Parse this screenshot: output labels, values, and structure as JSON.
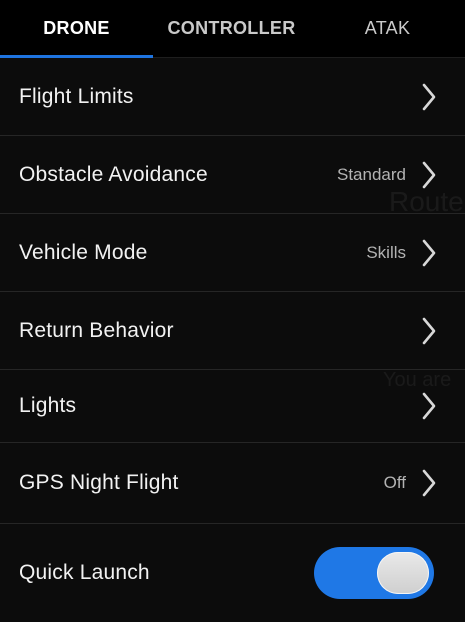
{
  "tabs": [
    {
      "label": "DRONE",
      "active": true
    },
    {
      "label": "CONTROLLER",
      "active": false
    },
    {
      "label": "ATAK",
      "active": false
    }
  ],
  "settings": [
    {
      "label": "Flight Limits",
      "value": ""
    },
    {
      "label": "Obstacle Avoidance",
      "value": "Standard"
    },
    {
      "label": "Vehicle Mode",
      "value": "Skills"
    },
    {
      "label": "Return Behavior",
      "value": ""
    },
    {
      "label": "Lights",
      "value": ""
    },
    {
      "label": "GPS Night Flight",
      "value": "Off"
    }
  ],
  "quick_launch": {
    "label": "Quick Launch",
    "enabled": true
  },
  "colors": {
    "accent": "#1e74e0",
    "toggle_on": "#1f78e6",
    "background": "#0c0c0c",
    "tabbar": "#000000"
  },
  "icons": {
    "chevron": "chevron-right-icon"
  }
}
